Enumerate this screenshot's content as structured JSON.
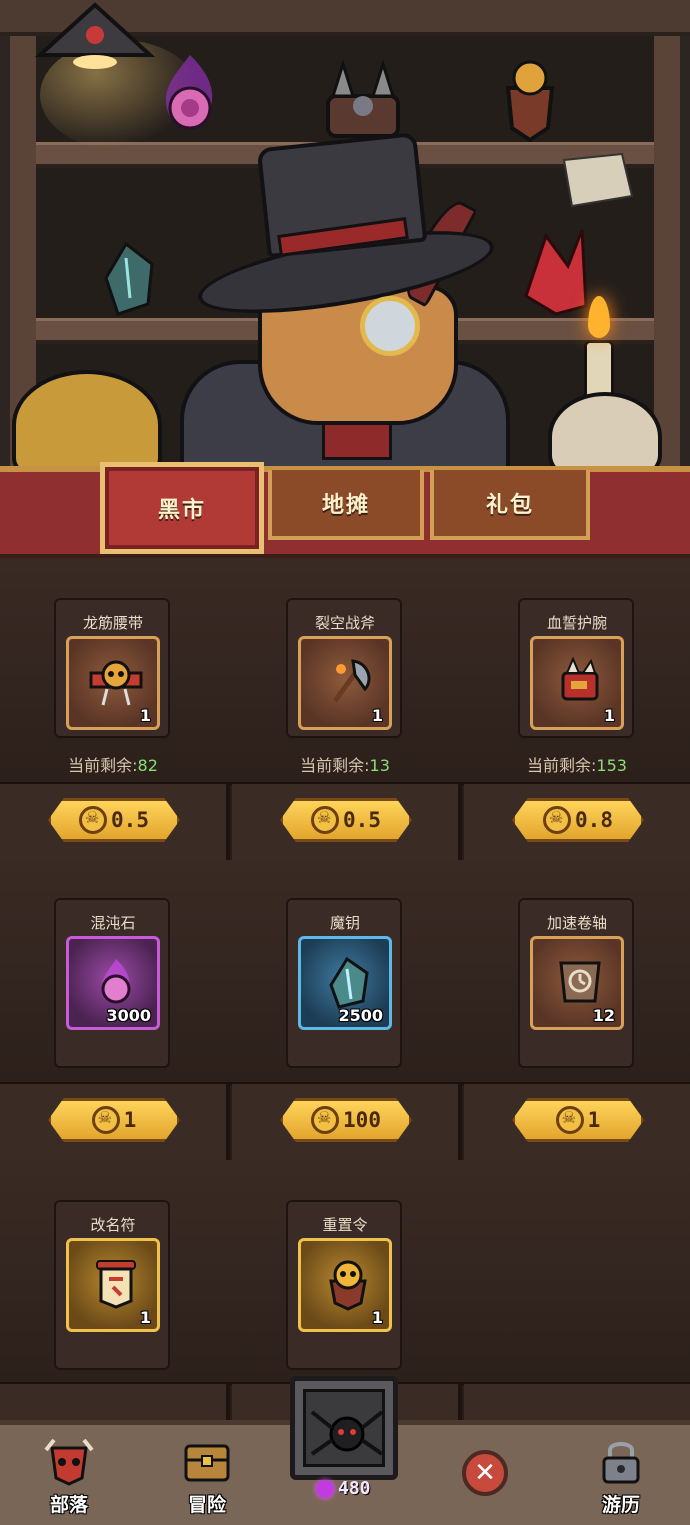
{
  "tabs": [
    {
      "label": "黑市",
      "active": true
    },
    {
      "label": "地摊",
      "active": false
    },
    {
      "label": "礼包",
      "active": false
    }
  ],
  "items": [
    {
      "name": "龙筋腰带",
      "count": "1",
      "remaining_label": "当前剩余:",
      "remaining": "82",
      "price": "0.5",
      "rarity": "orange",
      "icon": "skull-belt-icon"
    },
    {
      "name": "裂空战斧",
      "count": "1",
      "remaining_label": "当前剩余:",
      "remaining": "13",
      "price": "0.5",
      "rarity": "orange",
      "icon": "battle-axe-icon"
    },
    {
      "name": "血誓护腕",
      "count": "1",
      "remaining_label": "当前剩余:",
      "remaining": "153",
      "price": "0.8",
      "rarity": "orange",
      "icon": "spiked-bracer-icon"
    },
    {
      "name": "混沌石",
      "count": "3000",
      "price": "1",
      "rarity": "purple",
      "icon": "chaos-stone-icon"
    },
    {
      "name": "魔钥",
      "count": "2500",
      "price": "100",
      "rarity": "blue",
      "icon": "magic-key-crystal-icon"
    },
    {
      "name": "加速卷轴",
      "count": "12",
      "price": "1",
      "rarity": "orange",
      "icon": "speed-scroll-icon"
    },
    {
      "name": "改名符",
      "count": "1",
      "price": "",
      "rarity": "gold",
      "icon": "rename-banner-icon"
    },
    {
      "name": "重置令",
      "count": "1",
      "price": "",
      "rarity": "gold",
      "icon": "reset-token-icon"
    }
  ],
  "nav": {
    "tribe": "部落",
    "adventure": "冒险",
    "travel": "游历",
    "gem_count": "480"
  },
  "colors": {
    "accent_gold": "#e2a52d",
    "tab_red": "#b23a36",
    "remaining_green": "#8ddc7a"
  }
}
